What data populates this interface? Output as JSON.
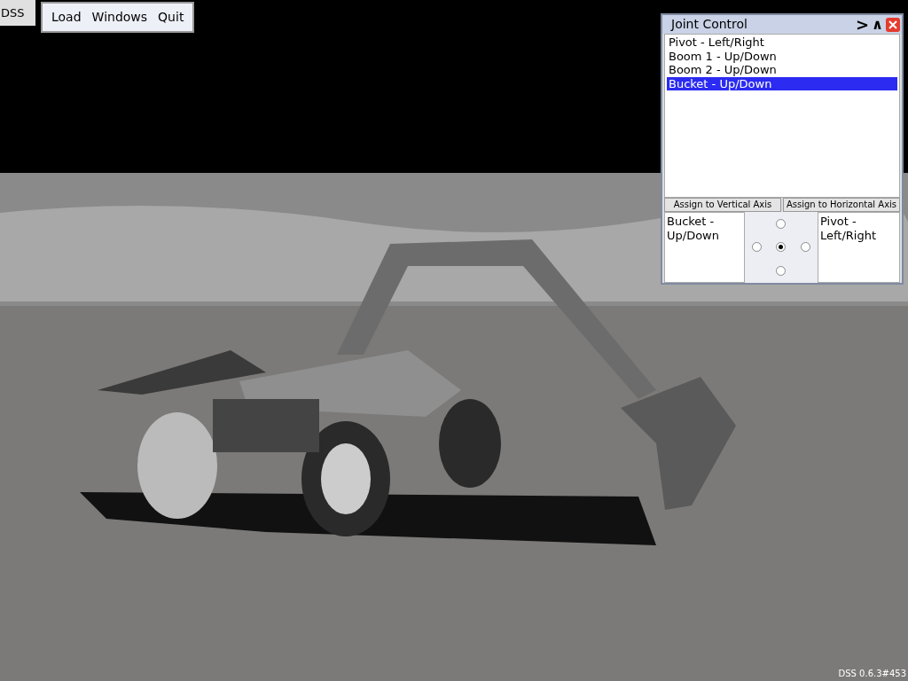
{
  "app_label": "DSS",
  "menu": [
    "Load",
    "Windows",
    "Quit"
  ],
  "joint_window": {
    "title": "Joint Control",
    "title_buttons": [
      {
        "kind": "next",
        "label": ">"
      },
      {
        "kind": "collapse",
        "label": "∧"
      },
      {
        "kind": "close"
      }
    ],
    "joints": [
      {
        "label": "Pivot - Left/Right",
        "selected": false
      },
      {
        "label": "Boom 1 - Up/Down",
        "selected": false
      },
      {
        "label": "Boom 2 - Up/Down",
        "selected": false
      },
      {
        "label": "Bucket - Up/Down",
        "selected": true
      }
    ],
    "assign_buttons": [
      "Assign to Vertical Axis",
      "Assign to Horizontal Axis"
    ],
    "vertical_axis": "Bucket - Up/Down",
    "horizontal_axis": "Pivot - Left/Right",
    "pad": [
      {
        "kind": "up",
        "selected": false
      },
      {
        "kind": "left",
        "selected": false
      },
      {
        "kind": "center",
        "selected": true
      },
      {
        "kind": "right",
        "selected": false
      },
      {
        "kind": "down",
        "selected": false
      }
    ]
  },
  "version": "DSS 0.6.3#453"
}
